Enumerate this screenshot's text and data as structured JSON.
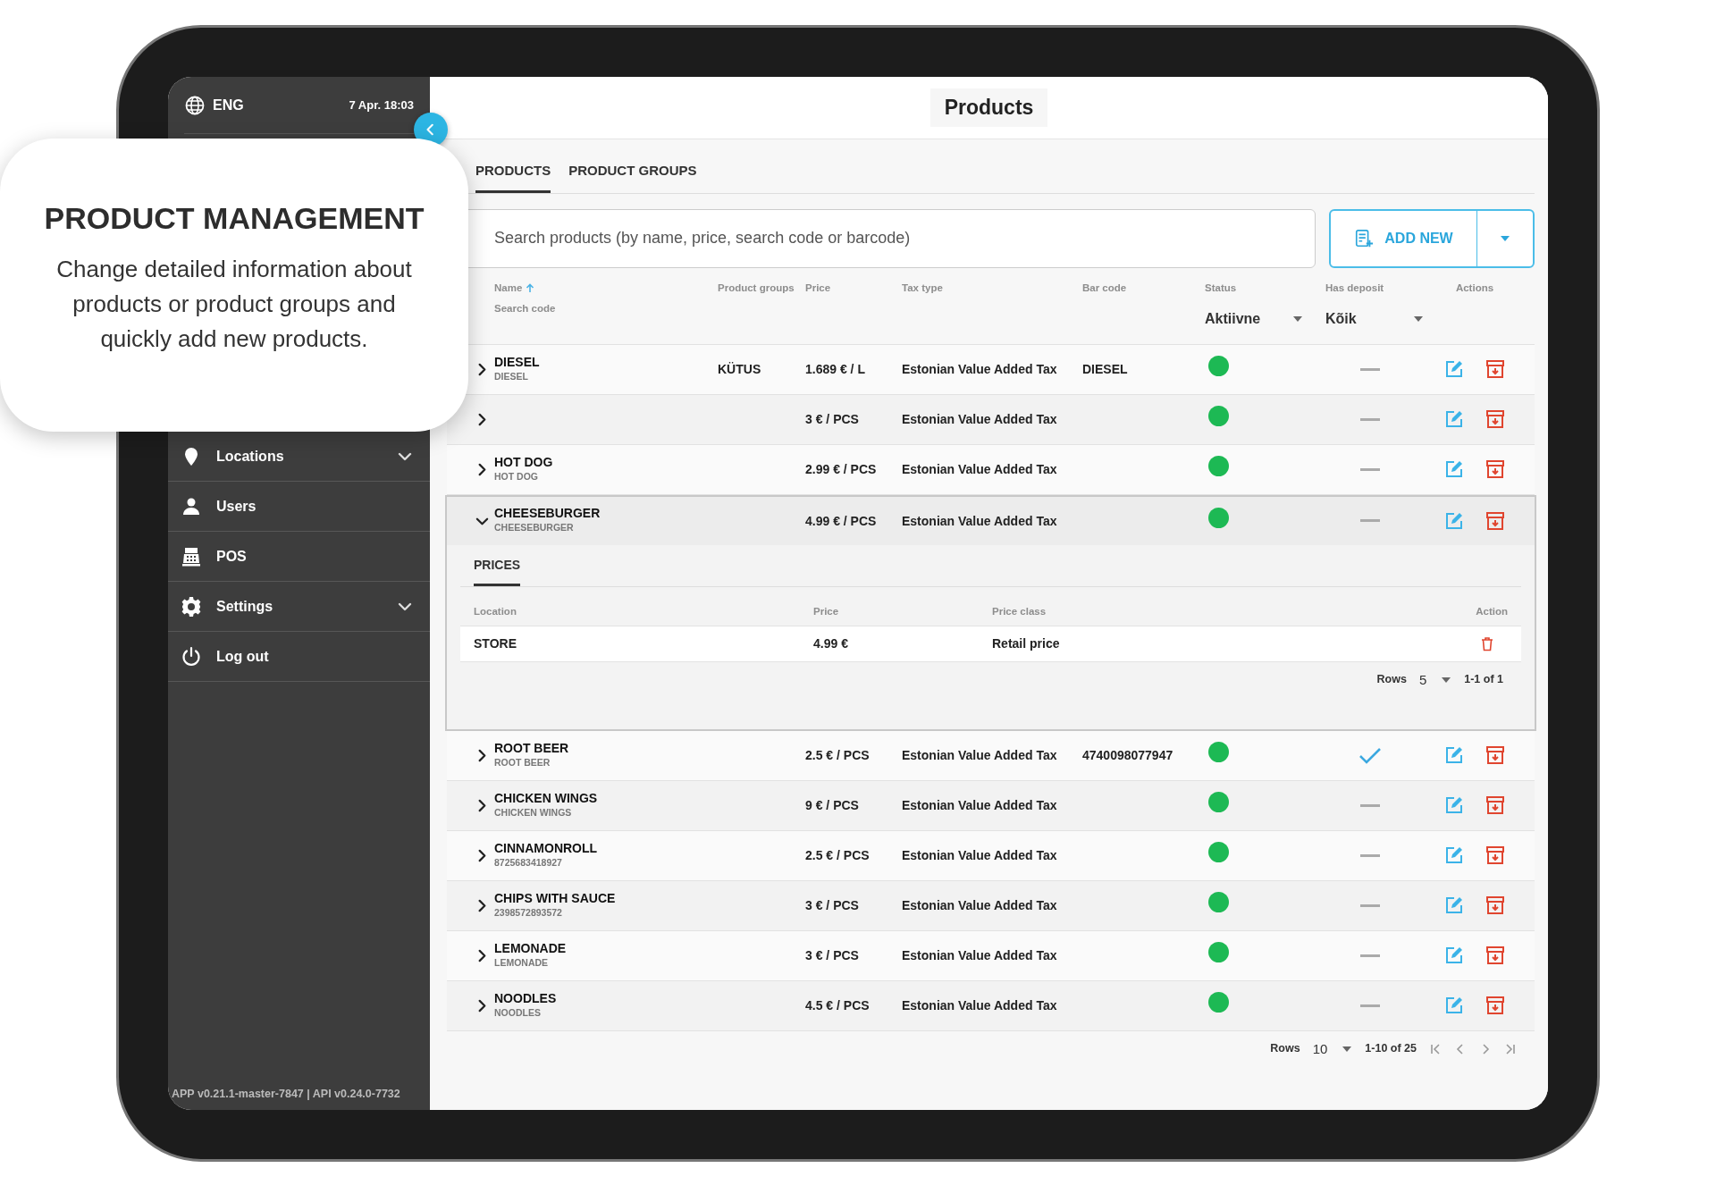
{
  "callout": {
    "title": "PRODUCT MANAGEMENT",
    "body": "Change detailed information about products or product groups and quickly add new products."
  },
  "sidebar": {
    "language": "ENG",
    "datetime": "7 Apr. 18:03",
    "items": [
      {
        "label": "Locations",
        "expandable": true
      },
      {
        "label": "Users",
        "expandable": false
      },
      {
        "label": "POS",
        "expandable": false
      },
      {
        "label": "Settings",
        "expandable": true
      },
      {
        "label": "Log out",
        "expandable": false
      }
    ],
    "version": "APP v0.21.1-master-7847 | API v0.24.0-7732"
  },
  "page_title": "Products",
  "tabs": [
    {
      "label": "PRODUCTS",
      "selected": true
    },
    {
      "label": "PRODUCT GROUPS",
      "selected": false
    }
  ],
  "search": {
    "placeholder": "Search products (by name, price, search code or barcode)"
  },
  "add_button": "ADD NEW",
  "table": {
    "columns": [
      {
        "label": "Name",
        "sublabel": "Search code",
        "sort_ascending": true
      },
      {
        "label": "Product groups"
      },
      {
        "label": "Price"
      },
      {
        "label": "Tax type"
      },
      {
        "label": "Bar code"
      },
      {
        "label": "Status",
        "filter": "Aktiivne"
      },
      {
        "label": "Has deposit",
        "filter": "Kõik"
      },
      {
        "label": "Actions"
      }
    ],
    "rows": [
      {
        "name": "DIESEL",
        "code": "DIESEL",
        "group": "KÜTUS",
        "price": "1.689 € / L",
        "tax": "Estonian Value Added Tax",
        "barcode": "DIESEL",
        "active": true,
        "has_deposit": false,
        "expanded": false
      },
      {
        "price": "3 € / PCS",
        "tax": "Estonian Value Added Tax",
        "active": true,
        "has_deposit": false,
        "expanded": false
      },
      {
        "name": "HOT DOG",
        "code": "HOT DOG",
        "price": "2.99 € / PCS",
        "tax": "Estonian Value Added Tax",
        "active": true,
        "has_deposit": false,
        "expanded": false
      },
      {
        "name": "CHEESEBURGER",
        "code": "CHEESEBURGER",
        "price": "4.99 € / PCS",
        "tax": "Estonian Value Added Tax",
        "active": true,
        "has_deposit": false,
        "expanded": true,
        "details": {
          "tabs": [
            {
              "label": "PRICES",
              "selected": true
            }
          ],
          "columns": [
            "Location",
            "Price",
            "Price class",
            "Action"
          ],
          "rows": [
            {
              "location": "STORE",
              "price": "4.99 €",
              "price_class": "Retail price"
            }
          ],
          "pagination": {
            "rows_label": "Rows",
            "rows_value": "5",
            "range": "1-1 of 1"
          }
        }
      },
      {
        "name": "ROOT BEER",
        "code": "ROOT BEER",
        "price": "2.5 € / PCS",
        "tax": "Estonian Value Added Tax",
        "barcode": "4740098077947",
        "active": true,
        "has_deposit": true,
        "expanded": false
      },
      {
        "name": "CHICKEN WINGS",
        "code": "CHICKEN WINGS",
        "price": "9 € / PCS",
        "tax": "Estonian Value Added Tax",
        "active": true,
        "has_deposit": false,
        "expanded": false
      },
      {
        "name": "CINNAMONROLL",
        "code": "8725683418927",
        "price": "2.5 € / PCS",
        "tax": "Estonian Value Added Tax",
        "active": true,
        "has_deposit": false,
        "expanded": false
      },
      {
        "name": "CHIPS WITH SAUCE",
        "code": "2398572893572",
        "price": "3 € / PCS",
        "tax": "Estonian Value Added Tax",
        "active": true,
        "has_deposit": false,
        "expanded": false
      },
      {
        "name": "LEMONADE",
        "code": "LEMONADE",
        "price": "3 € / PCS",
        "tax": "Estonian Value Added Tax",
        "active": true,
        "has_deposit": false,
        "expanded": false
      },
      {
        "name": "NOODLES",
        "code": "NOODLES",
        "price": "4.5 € / PCS",
        "tax": "Estonian Value Added Tax",
        "active": true,
        "has_deposit": false,
        "expanded": false
      }
    ],
    "pagination": {
      "rows_label": "Rows",
      "rows_value": "10",
      "range": "1-10 of 25"
    }
  }
}
